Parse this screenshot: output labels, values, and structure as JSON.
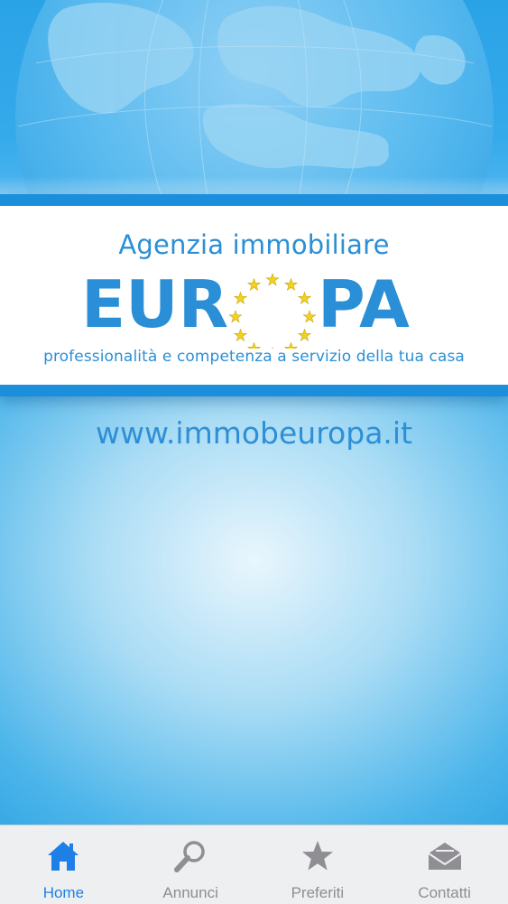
{
  "banner": {
    "tagline_top": "Agenzia immobiliare",
    "logo_text": "EUR",
    "logo_text_end": "PA",
    "tagline_bottom": "professionalità e competenza a servizio della tua casa"
  },
  "website": "www.immobeuropa.it",
  "tabbar": {
    "tabs": [
      {
        "label": "Home",
        "icon": "house-icon",
        "active": true
      },
      {
        "label": "Annunci",
        "icon": "magnifier-icon",
        "active": false
      },
      {
        "label": "Preferiti",
        "icon": "star-icon",
        "active": false
      },
      {
        "label": "Contatti",
        "icon": "envelope-icon",
        "active": false
      }
    ]
  },
  "colors": {
    "brand_blue": "#2a8fd6",
    "star_yellow": "#f3d21c",
    "tab_active": "#1e80e6",
    "tab_inactive": "#8e8e93"
  }
}
